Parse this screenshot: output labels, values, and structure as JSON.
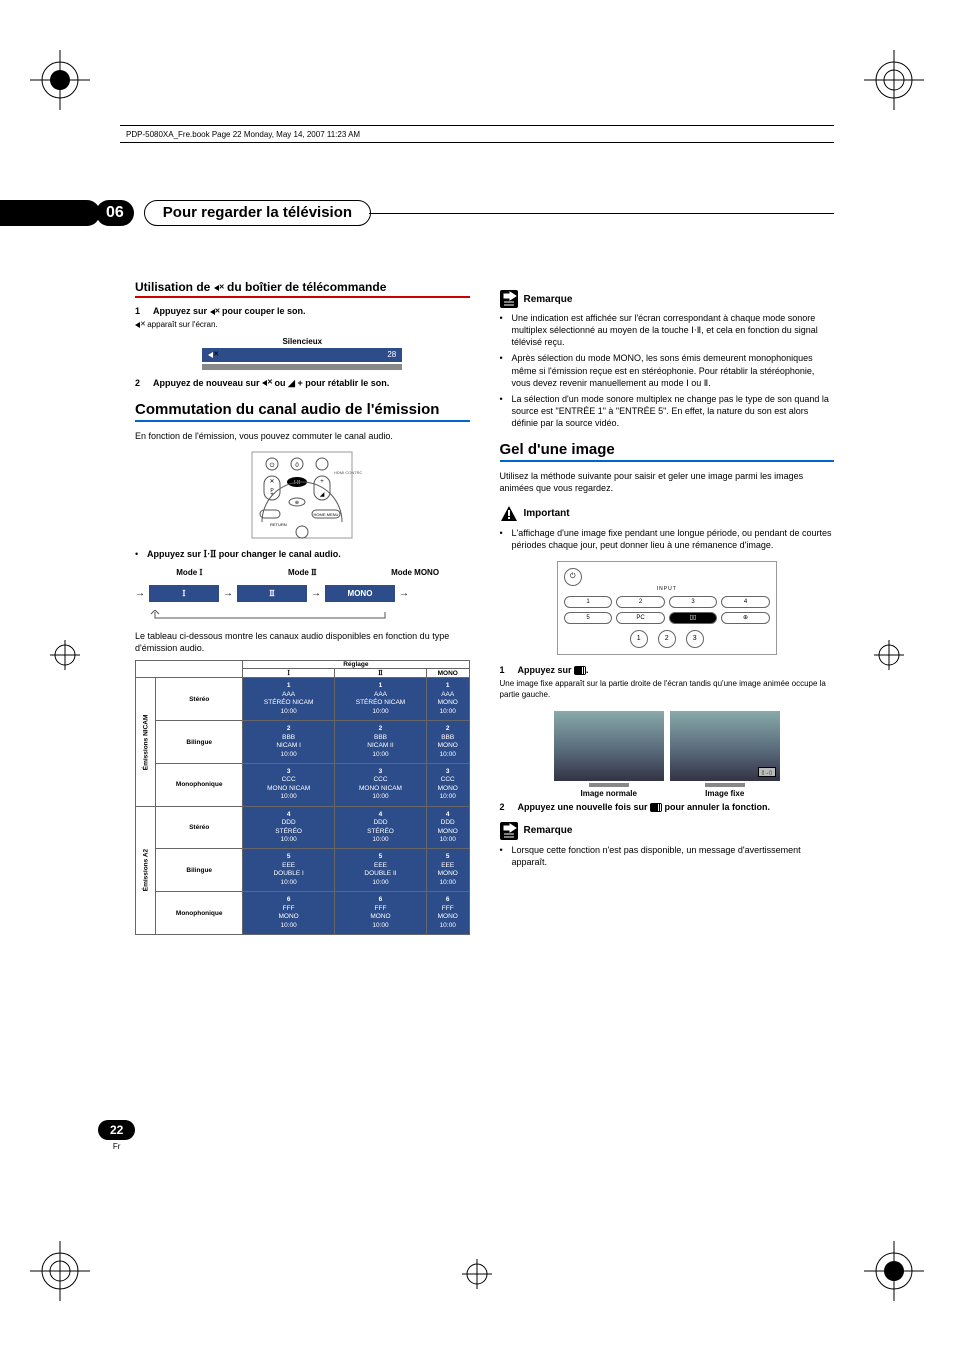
{
  "book_header": "PDP-5080XA_Fre.book  Page 22  Monday, May 14, 2007  11:23 AM",
  "chapter": {
    "number": "06",
    "title": "Pour regarder la télévision"
  },
  "left": {
    "h_mute": "Utilisation de e du boîtier de télécommande",
    "step1": "Appuyez sur e pour couper le son.",
    "step1_after": "e apparaît sur l'écran.",
    "mute_label": "Silencieux",
    "mute_value": "28",
    "step2": "Appuyez de nouveau sur e ou i + pour rétablir le son.",
    "h_audio": "Commutation du canal audio de l'émission",
    "p_audio": "En fonction de l'émission, vous pouvez commuter le canal audio.",
    "bullet_mode": "Appuyez sur f pour changer le canal audio.",
    "mode_labels": {
      "m1": "Mode f",
      "m2": "Mode g",
      "mono": "Mode MONO"
    },
    "mode_pills": {
      "m1": "f",
      "m2": "g",
      "mono": "MONO"
    },
    "p_table": "Le tableau ci-dessous montre les canaux audio disponibles en fonction du type d'émission audio.",
    "table": {
      "head": {
        "reglage": "Réglage",
        "c1": "f",
        "c2": "g",
        "mono": "MONO"
      },
      "groups": [
        {
          "name": "Émissions NICAM",
          "rows": [
            {
              "label": "Stéréo",
              "cells": [
                {
                  "n": "1",
                  "l1": "AAA",
                  "l2": "STÉRÉO NICAM",
                  "l3": "10:00"
                },
                {
                  "n": "1",
                  "l1": "AAA",
                  "l2": "STÉRÉO NICAM",
                  "l3": "10:00"
                },
                {
                  "n": "1",
                  "l1": "AAA",
                  "l2": "MONO",
                  "l3": "10:00"
                }
              ]
            },
            {
              "label": "Bilingue",
              "cells": [
                {
                  "n": "2",
                  "l1": "BBB",
                  "l2": "NICAM I",
                  "l3": "10:00"
                },
                {
                  "n": "2",
                  "l1": "BBB",
                  "l2": "NICAM II",
                  "l3": "10:00"
                },
                {
                  "n": "2",
                  "l1": "BBB",
                  "l2": "MONO",
                  "l3": "10:00"
                }
              ]
            },
            {
              "label": "Monophonique",
              "cells": [
                {
                  "n": "3",
                  "l1": "CCC",
                  "l2": "MONO NICAM",
                  "l3": "10:00"
                },
                {
                  "n": "3",
                  "l1": "CCC",
                  "l2": "MONO NICAM",
                  "l3": "10:00"
                },
                {
                  "n": "3",
                  "l1": "CCC",
                  "l2": "MONO",
                  "l3": "10:00"
                }
              ]
            }
          ]
        },
        {
          "name": "Émissions A2",
          "rows": [
            {
              "label": "Stéréo",
              "cells": [
                {
                  "n": "4",
                  "l1": "DDD",
                  "l2": "STÉRÉO",
                  "l3": "10:00"
                },
                {
                  "n": "4",
                  "l1": "DDD",
                  "l2": "STÉRÉO",
                  "l3": "10:00"
                },
                {
                  "n": "4",
                  "l1": "DDD",
                  "l2": "MONO",
                  "l3": "10:00"
                }
              ]
            },
            {
              "label": "Bilingue",
              "cells": [
                {
                  "n": "5",
                  "l1": "EEE",
                  "l2": "DOUBLE I",
                  "l3": "10:00"
                },
                {
                  "n": "5",
                  "l1": "EEE",
                  "l2": "DOUBLE II",
                  "l3": "10:00"
                },
                {
                  "n": "5",
                  "l1": "EEE",
                  "l2": "MONO",
                  "l3": "10:00"
                }
              ]
            },
            {
              "label": "Monophonique",
              "cells": [
                {
                  "n": "6",
                  "l1": "FFF",
                  "l2": "MONO",
                  "l3": "10:00"
                },
                {
                  "n": "6",
                  "l1": "FFF",
                  "l2": "MONO",
                  "l3": "10:00"
                },
                {
                  "n": "6",
                  "l1": "FFF",
                  "l2": "MONO",
                  "l3": "10:00"
                }
              ]
            }
          ]
        }
      ]
    }
  },
  "right": {
    "remarque": "Remarque",
    "note1": "Une indication est affichée sur l'écran correspondant à chaque mode sonore multiplex sélectionné au moyen de la touche f, et cela en fonction du signal télévisé reçu.",
    "note2": "Après sélection du mode MONO, les sons émis demeurent monophoniques même si l'émission reçue est en stéréophonie. Pour rétablir la stéréophonie, vous devez revenir manuellement au mode f ou g.",
    "note3": "La sélection d'un mode sonore multiplex ne change pas le type de son quand la source est \"ENTRÉE 1\" à \"ENTRÉE 5\". En effet, la nature du son est alors définie par la source vidéo.",
    "h_freeze": "Gel d'une image",
    "p_freeze": "Utilisez la méthode suivante pour saisir et geler une image parmi les images animées que vous regardez.",
    "important": "Important",
    "imp1": "L'affichage d'une image fixe pendant une longue période, ou pendant de courtes périodes chaque jour, peut donner lieu à une rémanence d'image.",
    "remote": {
      "input": "INPUT",
      "b1": "1",
      "b2": "2",
      "b3": "3",
      "b4": "4",
      "b5": "5",
      "bpc": "PC",
      "ba": "1",
      "bb": "2",
      "bc": "3"
    },
    "step1": "Appuyez sur d.",
    "step1_after": "Une image fixe apparaît sur la partie droite de l'écran tandis qu'une image animée occupe la partie gauche.",
    "cap_normal": "Image normale",
    "cap_fixe": "Image fixe",
    "step2": "Appuyez une nouvelle fois sur d pour annuler la fonction.",
    "note4": "Lorsque cette fonction n'est pas disponible, un message d'avertissement apparaît."
  },
  "page": {
    "num": "22",
    "lang": "Fr"
  }
}
